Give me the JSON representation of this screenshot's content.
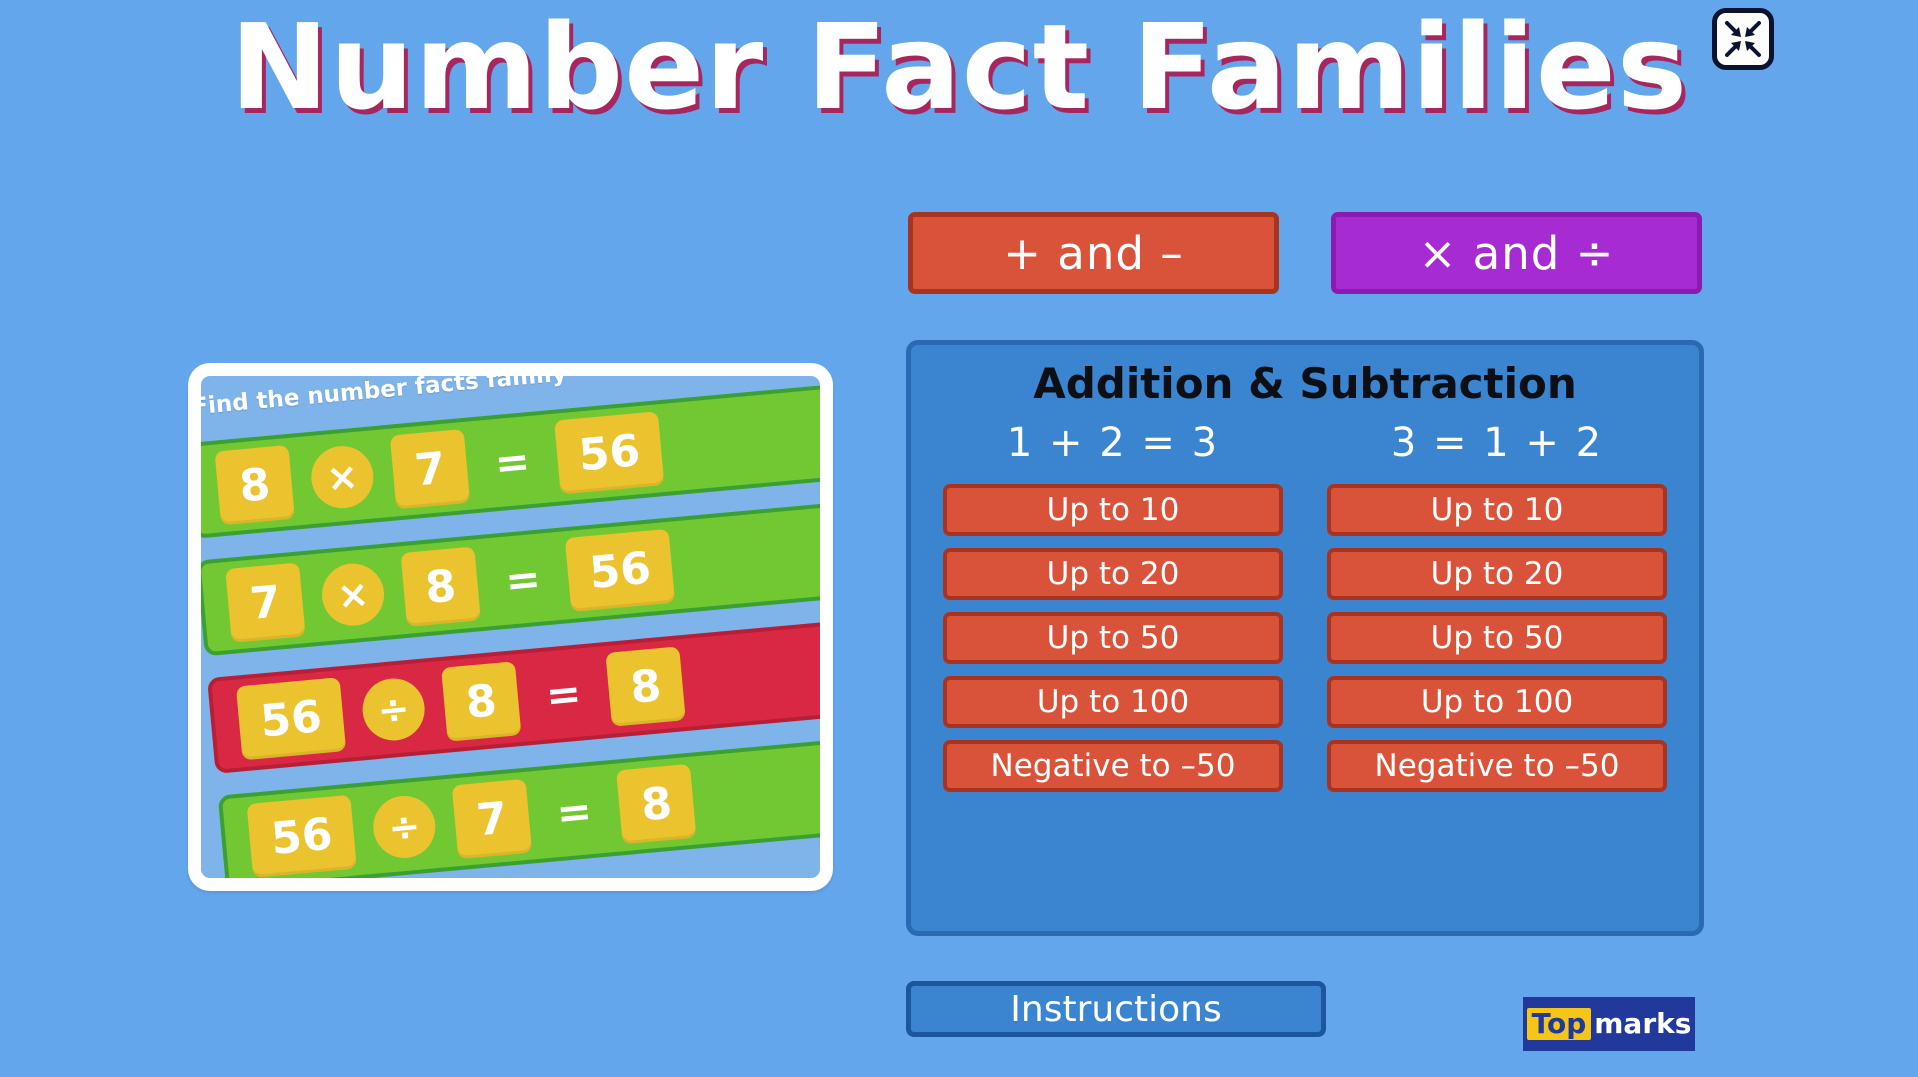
{
  "page": {
    "title": "Number Fact Families",
    "background_color": "#64a6ec",
    "title_color": "#ffffff",
    "title_shadow_color": "#a8265e"
  },
  "fullscreen_button": {
    "icon": "exit-fullscreen-icon",
    "label": "Exit full screen"
  },
  "preview_card": {
    "prompt": "Find the number facts family",
    "rows": [
      {
        "status": "green",
        "a": "8",
        "op": "×",
        "b": "7",
        "eq": "=",
        "result": "56"
      },
      {
        "status": "green",
        "a": "7",
        "op": "×",
        "b": "8",
        "eq": "=",
        "result": "56"
      },
      {
        "status": "red",
        "a": "56",
        "op": "÷",
        "b": "8",
        "eq": "=",
        "result": "8"
      },
      {
        "status": "green",
        "a": "56",
        "op": "÷",
        "b": "7",
        "eq": "=",
        "result": "8"
      }
    ],
    "colors": {
      "correct": "#72c832",
      "incorrect": "#d92843",
      "tile": "#ebc32f",
      "card_bg": "#7fb4ea"
    }
  },
  "mode_buttons": [
    {
      "label": "+ and –",
      "color": "#d9533a",
      "border": "#a8341f",
      "selected": true
    },
    {
      "label": "× and ÷",
      "color": "#a72bd2",
      "border": "#8a1bb0",
      "selected": false
    }
  ],
  "options_panel": {
    "title": "Addition & Subtraction",
    "panel_color": "#3a84d0",
    "columns": [
      {
        "heading": "1 + 2 = 3",
        "buttons": [
          "Up to 10",
          "Up to 20",
          "Up to 50",
          "Up to 100",
          "Negative to –50"
        ]
      },
      {
        "heading": "3 = 1 + 2",
        "buttons": [
          "Up to 10",
          "Up to 20",
          "Up to 50",
          "Up to 100",
          "Negative to –50"
        ]
      }
    ]
  },
  "instructions_button": {
    "label": "Instructions"
  },
  "logo": {
    "part1": "Top",
    "part2": "marks"
  }
}
